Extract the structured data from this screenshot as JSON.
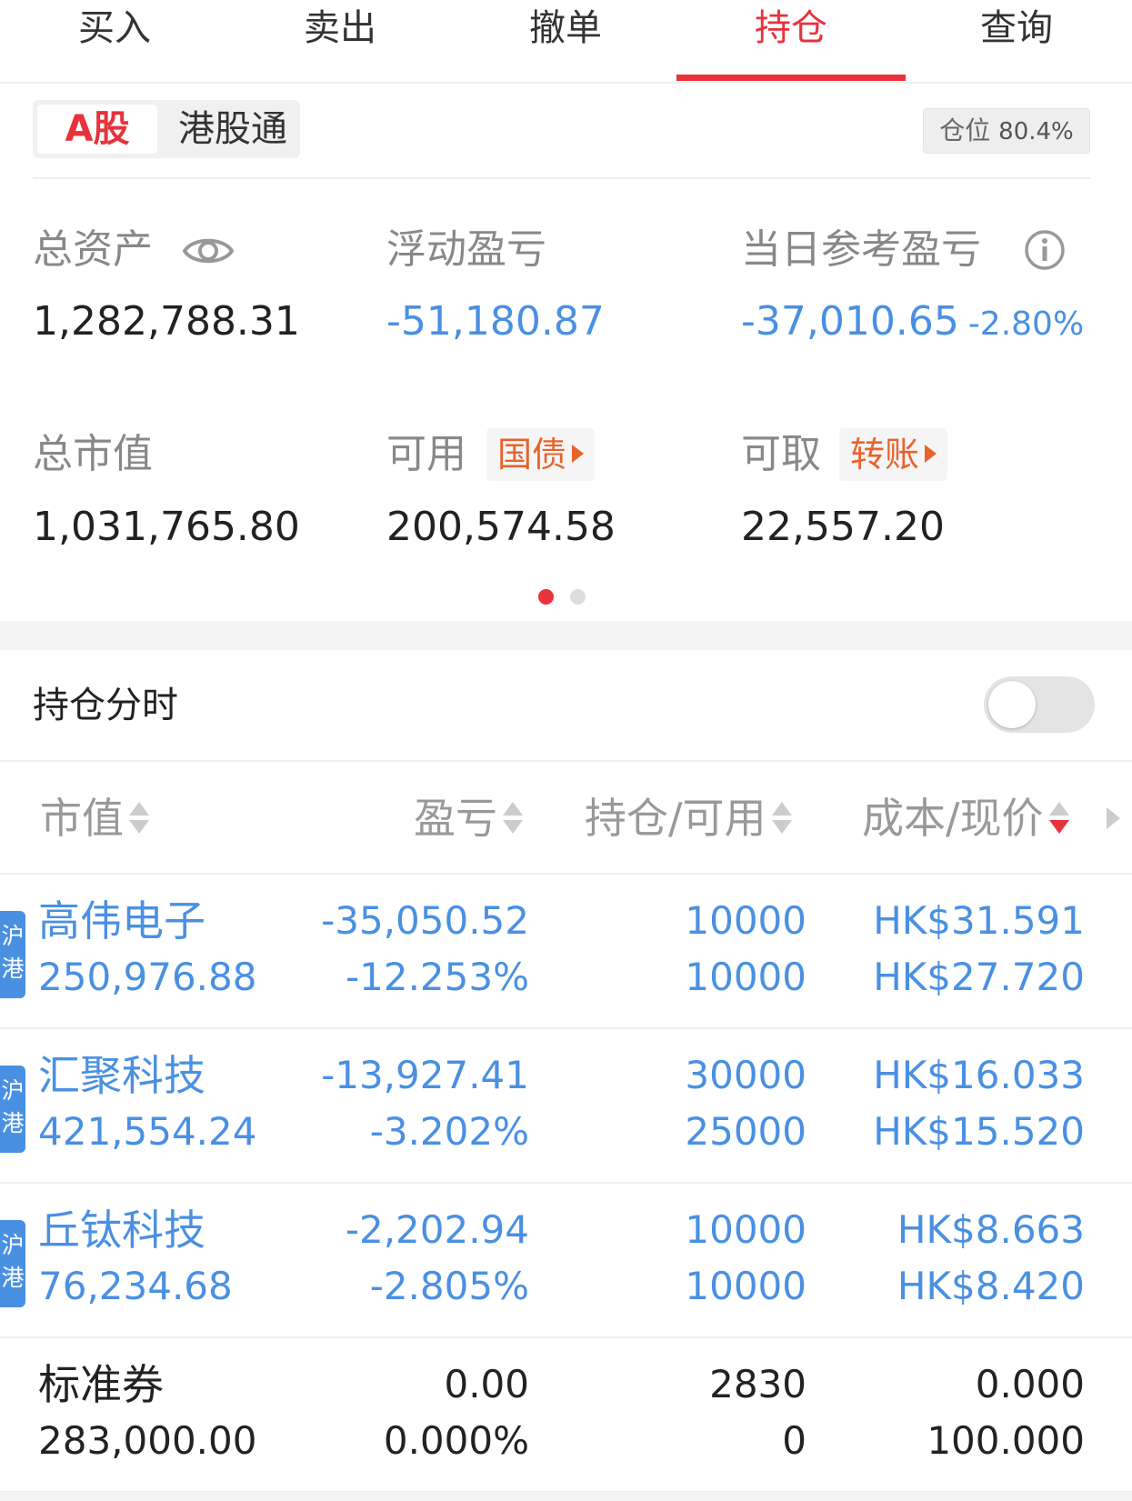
{
  "tabs": [
    {
      "label": "买入"
    },
    {
      "label": "卖出"
    },
    {
      "label": "撤单"
    },
    {
      "label": "持仓"
    },
    {
      "label": "查询"
    }
  ],
  "active_tab": "持仓",
  "market": {
    "active": "A股",
    "other": "港股通"
  },
  "position_badge": {
    "label": "仓位",
    "value": "80.4%"
  },
  "summary": {
    "total_assets": {
      "label": "总资产",
      "value": "1,282,788.31"
    },
    "floating_pl": {
      "label": "浮动盈亏",
      "value": "-51,180.87"
    },
    "today_pl": {
      "label": "当日参考盈亏",
      "value": "-37,010.65",
      "percent": "-2.80%"
    },
    "market_value": {
      "label": "总市值",
      "value": "1,031,765.80"
    },
    "available": {
      "label": "可用",
      "value": "200,574.58",
      "action": "国债"
    },
    "withdrawable": {
      "label": "可取",
      "value": "22,557.20",
      "action": "转账"
    }
  },
  "holdings_timeshare": {
    "label": "持仓分时",
    "enabled": false
  },
  "columns": [
    {
      "label": "市值"
    },
    {
      "label": "盈亏"
    },
    {
      "label": "持仓/可用"
    },
    {
      "label": "成本/现价"
    }
  ],
  "holdings": [
    {
      "tag": "沪港",
      "name": "高伟电子",
      "market_value": "250,976.88",
      "pl": "-35,050.52",
      "pl_pct": "-12.253%",
      "position": "10000",
      "available": "10000",
      "cost": "HK$31.591",
      "price": "HK$27.720"
    },
    {
      "tag": "沪港",
      "name": "汇聚科技",
      "market_value": "421,554.24",
      "pl": "-13,927.41",
      "pl_pct": "-3.202%",
      "position": "30000",
      "available": "25000",
      "cost": "HK$16.033",
      "price": "HK$15.520"
    },
    {
      "tag": "沪港",
      "name": "丘钛科技",
      "market_value": "76,234.68",
      "pl": "-2,202.94",
      "pl_pct": "-2.805%",
      "position": "10000",
      "available": "10000",
      "cost": "HK$8.663",
      "price": "HK$8.420"
    },
    {
      "tag": "",
      "name": "标准券",
      "market_value": "283,000.00",
      "pl": "0.00",
      "pl_pct": "0.000%",
      "position": "2830",
      "available": "0",
      "cost": "0.000",
      "price": "100.000"
    }
  ],
  "colors": {
    "accent_red": "#e8323c",
    "loss_blue": "#4a90e2",
    "action_orange": "#e8632c"
  },
  "icons": {
    "eye": "eye-icon",
    "info": "info-icon"
  }
}
